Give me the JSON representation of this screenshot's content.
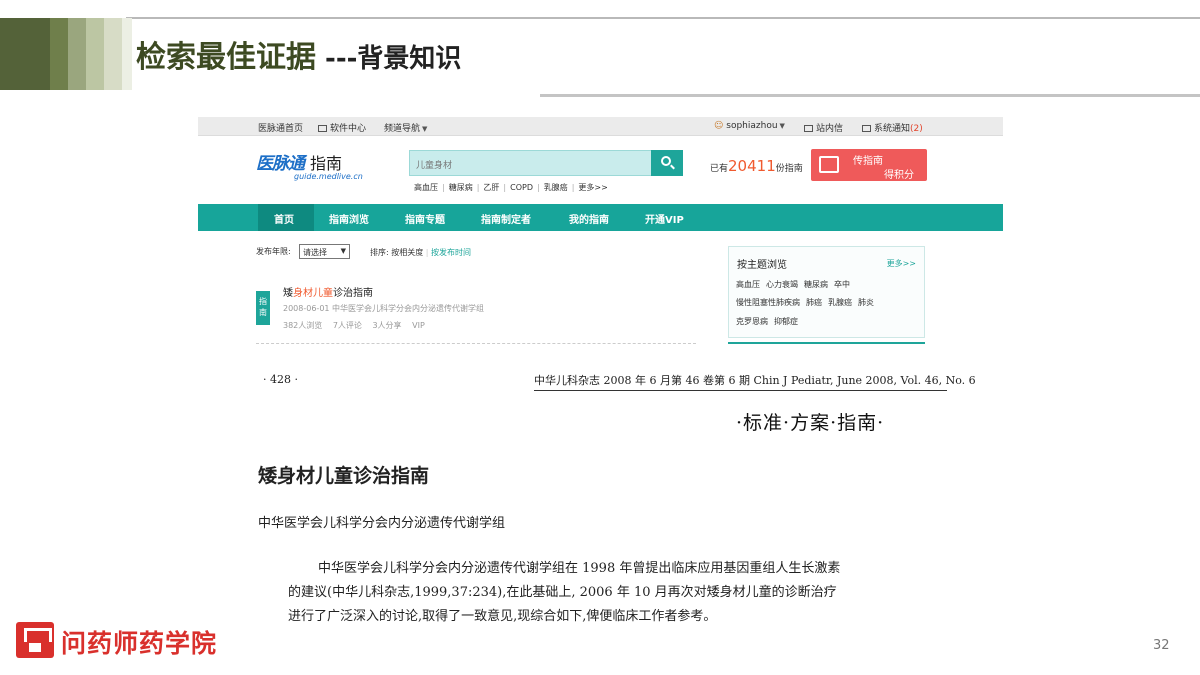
{
  "slide": {
    "title": "检索最佳证据",
    "subtitle": " ---背景知识",
    "header_colors": [
      "#546239",
      "#6f7f4b",
      "#9aa67e",
      "#bcc6a3",
      "#d7dcc6",
      "#ecefe4"
    ],
    "page_number": "32"
  },
  "site": {
    "topbar": {
      "home": "医脉通首页",
      "software": "软件中心",
      "channels": "频道导航",
      "user": "sophiazhou",
      "messages": "站内信",
      "notice": "系统通知",
      "notice_count": "(2)"
    },
    "logo": {
      "mark": "医脉通",
      "product": "指南",
      "domain": "guide.medlive.cn"
    },
    "search": {
      "value": "儿童身材",
      "hot_tags": [
        "高血压",
        "糖尿病",
        "乙肝",
        "COPD",
        "乳腺癌",
        "更多>>"
      ]
    },
    "count": {
      "prefix": "已有",
      "number": "20411",
      "suffix": "份指南"
    },
    "upload": {
      "line1": "传指南",
      "line2": "得积分"
    },
    "nav": [
      "首页",
      "指南浏览",
      "指南专题",
      "指南制定者",
      "我的指南",
      "开通VIP"
    ],
    "filter": {
      "year_label": "发布年限:",
      "year_value": "请选择",
      "sort_label": "排序:",
      "sort_relevance": "按相关度",
      "sort_date": "按发布时间"
    },
    "result": {
      "tag": "指南",
      "title_before": "矮",
      "title_hl1": "身材",
      "title_hl2": "儿童",
      "title_after": "诊治指南",
      "meta": "2008-06-01 中华医学会儿科学分会内分泌遗传代谢学组",
      "views": "382人浏览",
      "comments": "7人评论",
      "shares": "3人分享",
      "vip": "VIP"
    },
    "topics": {
      "heading": "按主题浏览",
      "more": "更多>>",
      "row1": [
        "高血压",
        "心力衰竭",
        "糖尿病",
        "卒中"
      ],
      "row2": [
        "慢性阻塞性肺疾病",
        "肺癌",
        "乳腺癌",
        "肺炎"
      ],
      "row3": [
        "克罗恩病",
        "抑郁症"
      ]
    }
  },
  "journal": {
    "page": "· 428 ·",
    "info": "中华儿科杂志 2008 年 6 月第 46 卷第 6 期   Chin J Pediatr, June 2008, Vol. 46, No. 6",
    "category": "·标准·方案·指南·",
    "article_title": "矮身材儿童诊治指南",
    "authors": "中华医学会儿科学分会内分泌遗传代谢学组",
    "para1": "中华医学会儿科学分会内分泌遗传代谢学组在 1998 年曾提出临床应用基因重组人生长激素",
    "para2": "的建议(中华儿科杂志,1999,37:234),在此基础上, 2006 年 10 月再次对矮身材儿童的诊断治疗",
    "para3": "进行了广泛深入的讨论,取得了一致意见,现综合如下,俾便临床工作者参考。"
  },
  "footer": {
    "brand": "问药师药学院"
  }
}
